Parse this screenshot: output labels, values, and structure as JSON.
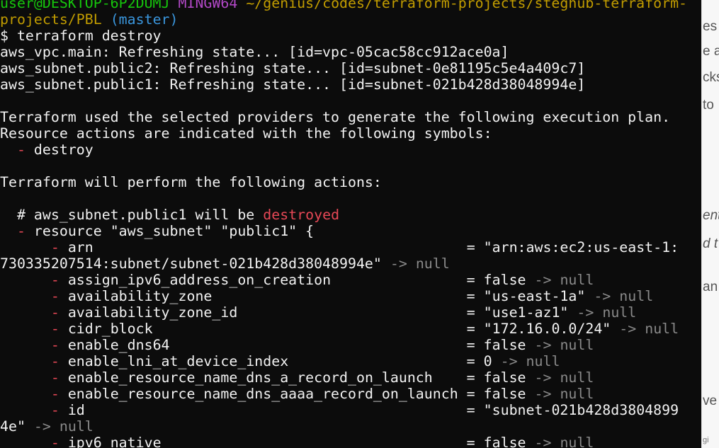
{
  "terminal": {
    "prompt_user_host": "user@DESKTOP-6P2DUMJ",
    "prompt_env": "MINGW64",
    "prompt_path_1": "~/genius/codes/terraform-projects/steghub-terraform-",
    "prompt_path_2": "projects/PBL",
    "prompt_branch": "(master)",
    "command": "$ terraform destroy",
    "refresh_lines": [
      "aws_vpc.main: Refreshing state... [id=vpc-05cac58cc912ace0a]",
      "aws_subnet.public2: Refreshing state... [id=subnet-0e81195c5e4a409c7]",
      "aws_subnet.public1: Refreshing state... [id=subnet-021b428d38048994e]"
    ],
    "plan_intro_1": "Terraform used the selected providers to generate the following execution plan.",
    "plan_intro_2": "Resource actions are indicated with the following symbols:",
    "symbol_line": "destroy",
    "perform_line": "Terraform will perform the following actions:",
    "resource_comment_a": "# aws_subnet.public1",
    "resource_comment_b": "will be",
    "resource_comment_destroyed": "destroyed",
    "resource_decl": "resource \"aws_subnet\" \"public1\" {",
    "attributes": [
      {
        "name": "arn",
        "value": "\"arn:aws:ec2:us-east-1:"
      },
      {
        "name": "assign_ipv6_address_on_creation",
        "value": "false"
      },
      {
        "name": "availability_zone",
        "value": "\"us-east-1a\""
      },
      {
        "name": "availability_zone_id",
        "value": "\"use1-az1\""
      },
      {
        "name": "cidr_block",
        "value": "\"172.16.0.0/24\""
      },
      {
        "name": "enable_dns64",
        "value": "false"
      },
      {
        "name": "enable_lni_at_device_index",
        "value": "0"
      },
      {
        "name": "enable_resource_name_dns_a_record_on_launch",
        "value": "false"
      },
      {
        "name": "enable_resource_name_dns_aaaa_record_on_launch",
        "value": "false"
      },
      {
        "name": "id",
        "value": "\"subnet-021b428d3804899"
      },
      {
        "name": "ipv6_native",
        "value": "false"
      }
    ],
    "arn_continuation": "730335207514:subnet/subnet-021b428d38048994e\"",
    "id_continuation": "4e\"",
    "minus": "-",
    "arrow": "->",
    "null": "null",
    "equals": "="
  },
  "background_doc": {
    "fragments": [
      "es",
      "e a",
      "cks",
      "to",
      "ent",
      "d t",
      "an",
      "ve",
      "gi"
    ]
  }
}
